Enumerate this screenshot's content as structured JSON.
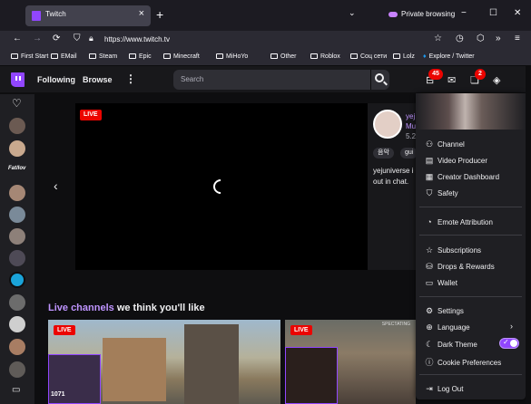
{
  "browser": {
    "tab_title": "Twitch",
    "close_glyph": "×",
    "new_tab_glyph": "+",
    "tab_list_glyph": "⌄",
    "private_label": "Private browsing",
    "url": "https://www.twitch.tv",
    "minimize_glyph": "−",
    "maximize_glyph": "☐",
    "window_close_glyph": "✕",
    "back_glyph": "←",
    "forward_glyph": "→",
    "reload_glyph": "⟳",
    "star_glyph": "☆",
    "menu_glyph": "≡",
    "overflow_glyph": "»",
    "bookmarks": [
      "First Start",
      "EMail",
      "Steam",
      "Epic",
      "Minecraft",
      "MiHoYo",
      "Other",
      "Roblox",
      "Соц сети",
      "Lolz",
      "Explore / Twitter"
    ]
  },
  "twitch": {
    "nav_following": "Following",
    "nav_browse": "Browse",
    "kebab_glyph": "⋮",
    "search_placeholder": "Search",
    "inbox_badge": "45",
    "notif_badge": "2",
    "live_label": "LIVE",
    "carousel_prev_glyph": "‹",
    "heart_glyph": "♡",
    "sidebar_brand_text": "Fat/lov",
    "camera_glyph": "▭",
    "channel": {
      "name": "yej",
      "game": "Mu",
      "viewers": "5.2",
      "tags": [
        "음악",
        "gui"
      ],
      "description": "yejuniverse i out in chat."
    },
    "section_highlight": "Live channels",
    "section_rest": " we think you'll like",
    "thumb1_cam_text": "1071",
    "thumb2_label": "SPECTATING"
  },
  "menu": {
    "items": [
      {
        "icon": "person-icon",
        "glyph": "⚇",
        "label": "Channel"
      },
      {
        "icon": "video-producer-icon",
        "glyph": "▤",
        "label": "Video Producer"
      },
      {
        "icon": "dashboard-icon",
        "glyph": "▦",
        "label": "Creator Dashboard"
      },
      {
        "icon": "shield-icon",
        "glyph": "⛉",
        "label": "Safety"
      },
      {
        "icon": "emote-icon",
        "glyph": "◔",
        "label": "Emote Attribution"
      },
      {
        "icon": "star-icon",
        "glyph": "☆",
        "label": "Subscriptions"
      },
      {
        "icon": "drops-icon",
        "glyph": "⛁",
        "label": "Drops & Rewards"
      },
      {
        "icon": "wallet-icon",
        "glyph": "▭",
        "label": "Wallet"
      },
      {
        "icon": "gear-icon",
        "glyph": "⚙",
        "label": "Settings"
      },
      {
        "icon": "globe-icon",
        "glyph": "⊕",
        "label": "Language"
      },
      {
        "icon": "moon-icon",
        "glyph": "☾",
        "label": "Dark Theme"
      },
      {
        "icon": "info-icon",
        "glyph": "ⓘ",
        "label": "Cookie Preferences"
      },
      {
        "icon": "logout-icon",
        "glyph": "⇥",
        "label": "Log Out"
      }
    ],
    "language_chevron": "›",
    "toggle_check": "✓"
  },
  "colors": {
    "accent": "#9146ff",
    "live": "#eb0400",
    "highlight": "#bf94ff"
  }
}
